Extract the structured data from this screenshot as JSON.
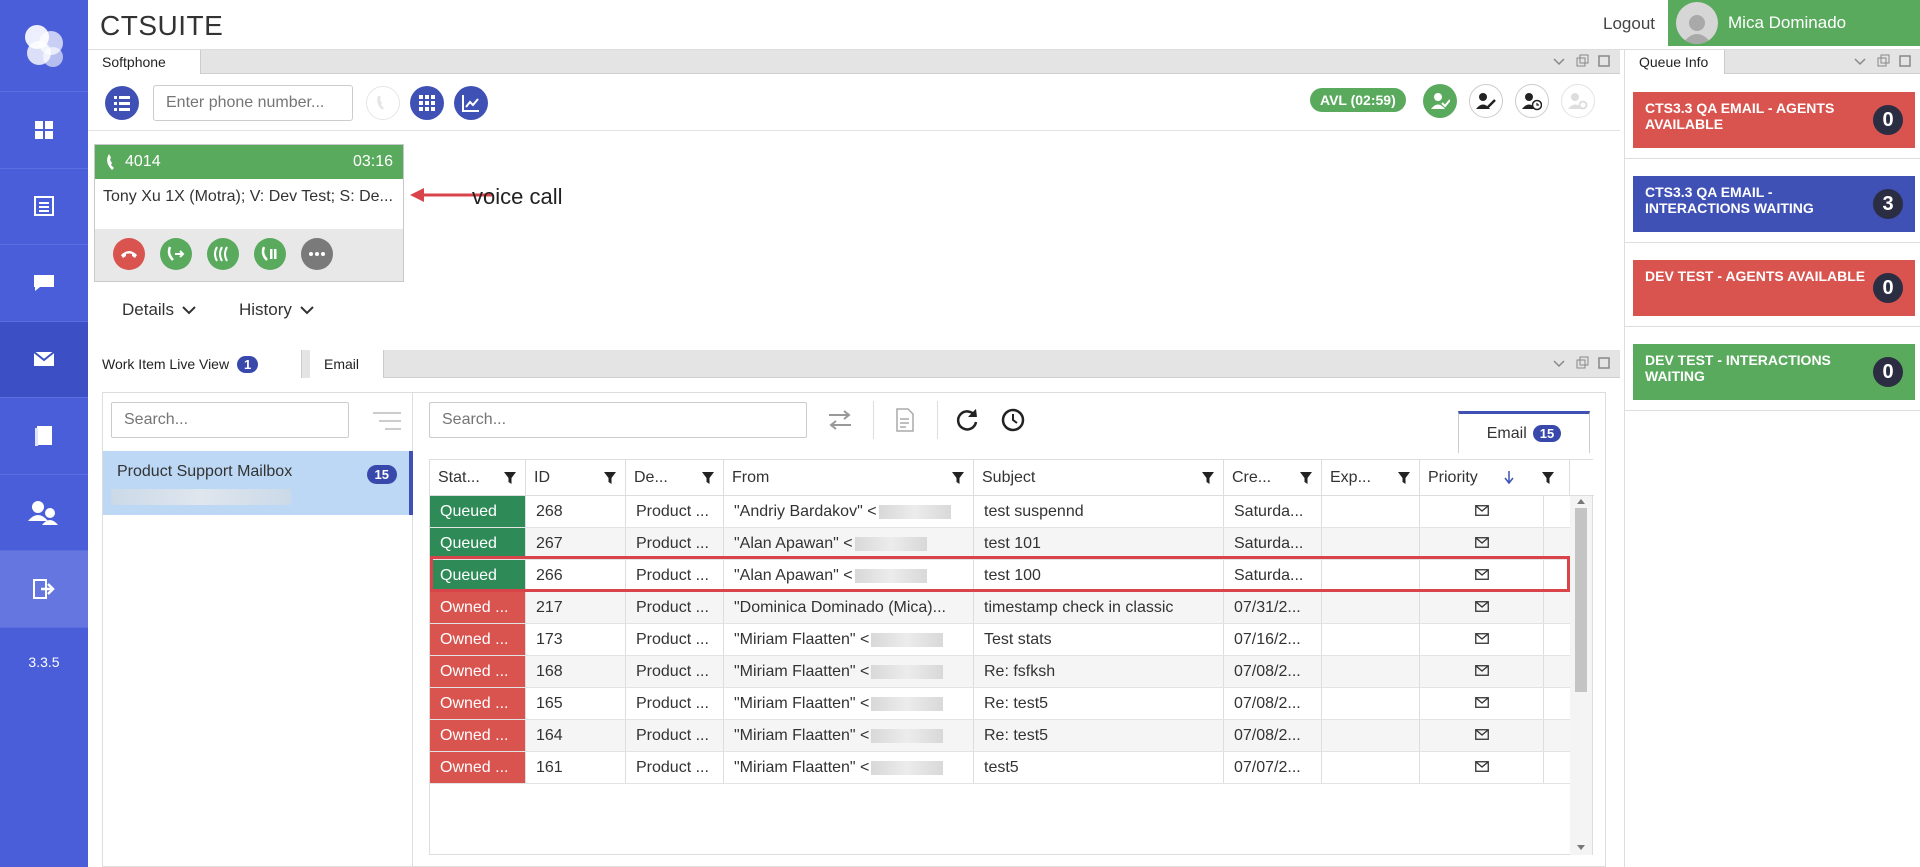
{
  "header": {
    "brand": "CTSUITE",
    "logout": "Logout",
    "user_name": "Mica Dominado"
  },
  "nav": {
    "version": "3.3.5"
  },
  "softphone": {
    "tab": "Softphone",
    "phone_placeholder": "Enter phone number...",
    "avl": "AVL (02:59)",
    "call": {
      "number": "4014",
      "timer": "03:16",
      "description": "Tony Xu 1X (Motra); V: Dev Test; S: De..."
    },
    "annotation": "voice call",
    "details_label": "Details",
    "history_label": "History"
  },
  "work_item": {
    "tab": "Work Item Live View",
    "tab_count": "1",
    "tab2": "Email",
    "mailbox_search_placeholder": "Search...",
    "grid_search_placeholder": "Search...",
    "mailbox": {
      "name": "Product Support Mailbox",
      "count": "15"
    },
    "email_tab": {
      "label": "Email",
      "count": "15"
    },
    "columns": [
      "Stat...",
      "ID",
      "De...",
      "From",
      "Subject",
      "Cre...",
      "Exp...",
      "Priority"
    ],
    "rows": [
      {
        "status": "Queued",
        "id": "268",
        "dept": "Product ...",
        "from": "\"Andriy Bardakov\" <",
        "subject": "test suspennd",
        "created": "Saturda..."
      },
      {
        "status": "Queued",
        "id": "267",
        "dept": "Product ...",
        "from": "\"Alan Apawan\" <",
        "subject": "test 101",
        "created": "Saturda..."
      },
      {
        "status": "Queued",
        "id": "266",
        "dept": "Product ...",
        "from": "\"Alan Apawan\" <",
        "subject": "test 100",
        "created": "Saturda..."
      },
      {
        "status": "Owned ...",
        "id": "217",
        "dept": "Product ...",
        "from": "\"Dominica Dominado (Mica)...",
        "subject": "timestamp check in classic",
        "created": "07/31/2..."
      },
      {
        "status": "Owned ...",
        "id": "173",
        "dept": "Product ...",
        "from": "\"Miriam Flaatten\" <",
        "subject": "Test stats",
        "created": "07/16/2..."
      },
      {
        "status": "Owned ...",
        "id": "168",
        "dept": "Product ...",
        "from": "\"Miriam Flaatten\" <",
        "subject": "Re: fsfksh",
        "created": "07/08/2..."
      },
      {
        "status": "Owned ...",
        "id": "165",
        "dept": "Product ...",
        "from": "\"Miriam Flaatten\" <",
        "subject": "Re: test5",
        "created": "07/08/2..."
      },
      {
        "status": "Owned ...",
        "id": "164",
        "dept": "Product ...",
        "from": "\"Miriam Flaatten\" <",
        "subject": "Re: test5",
        "created": "07/08/2..."
      },
      {
        "status": "Owned ...",
        "id": "161",
        "dept": "Product ...",
        "from": "\"Miriam Flaatten\" <",
        "subject": "test5",
        "created": "07/07/2..."
      }
    ]
  },
  "queue_info": {
    "tab": "Queue Info",
    "cards": [
      {
        "label": "CTS3.3 QA EMAIL - AGENTS AVAILABLE",
        "count": "0",
        "color": "#d9534f"
      },
      {
        "label": "CTS3.3 QA EMAIL - INTERACTIONS WAITING",
        "count": "3",
        "color": "#3f51b5"
      },
      {
        "label": "DEV TEST - AGENTS AVAILABLE",
        "count": "0",
        "color": "#d9534f"
      },
      {
        "label": "DEV TEST - INTERACTIONS WAITING",
        "count": "0",
        "color": "#5aaa5e"
      }
    ]
  },
  "colors": {
    "nav": "#4a5ed9",
    "queued": "#2e8b57",
    "owned": "#d9534f",
    "green": "#5aaa5e",
    "highlight": "#d9434a"
  }
}
